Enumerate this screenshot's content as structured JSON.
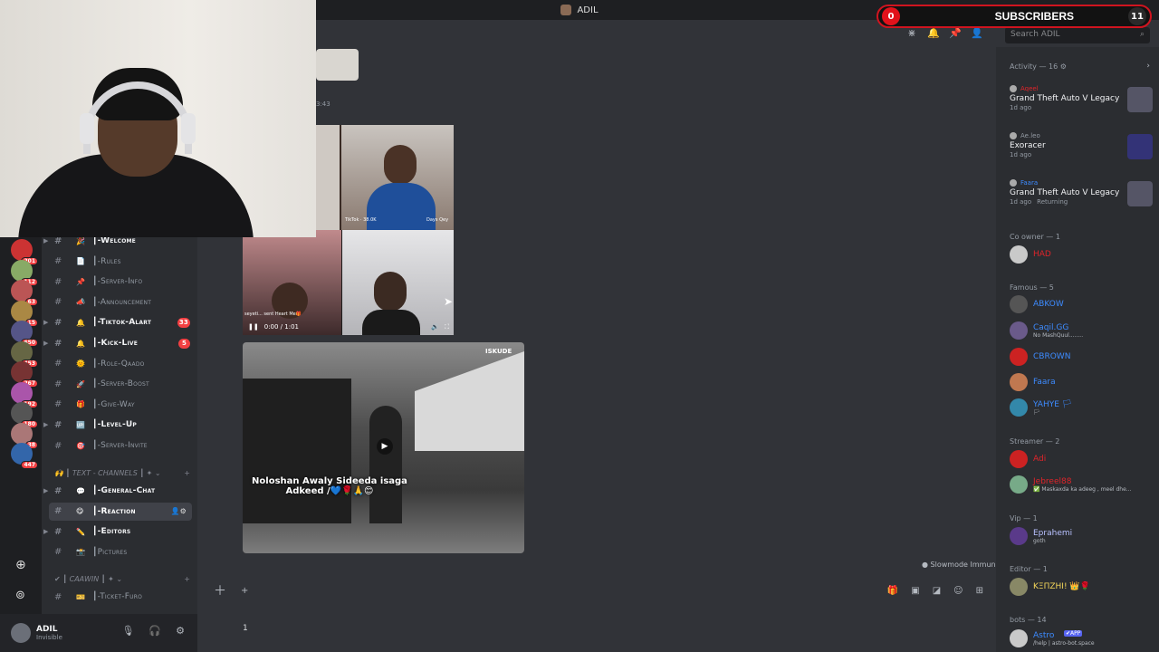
{
  "titlebar": {
    "server_name": "ADIL"
  },
  "overlay": {
    "subscribers_count": "0",
    "subscribers_label": "SUBSCRIBERS",
    "goal_number": "11"
  },
  "search": {
    "placeholder": "Search ADIL"
  },
  "guild_badges": [
    "201",
    "112",
    "63",
    "15",
    "650",
    "453",
    "267",
    "192",
    "180",
    "38",
    "447"
  ],
  "channels": [
    {
      "emoji": "🎉",
      "name": "┃-Welcome",
      "bold": true
    },
    {
      "emoji": "📄",
      "name": "┃-Rules",
      "bold": false
    },
    {
      "emoji": "📌",
      "name": "┃-Server-Info",
      "bold": false
    },
    {
      "emoji": "📣",
      "name": "┃-Announcement",
      "bold": false
    },
    {
      "emoji": "🔔",
      "name": "┃-Tiktok-Alart",
      "bold": true,
      "badge": "33"
    },
    {
      "emoji": "🔔",
      "name": "┃-Kick-Live",
      "bold": true,
      "badge": "5"
    },
    {
      "emoji": "🌞",
      "name": "┃-Role-Qaado",
      "bold": false
    },
    {
      "emoji": "🚀",
      "name": "┃-Server-Boost",
      "bold": false
    },
    {
      "emoji": "🎁",
      "name": "┃-Give-Way",
      "bold": false
    },
    {
      "emoji": "🆙",
      "name": "┃-Level-Up",
      "bold": true
    },
    {
      "emoji": "🎯",
      "name": "┃-Server-Invite",
      "bold": false
    }
  ],
  "category_text": "🙌 ┃ TEXT - CHANNELS ┃ ✦ ⌄",
  "channels2": [
    {
      "emoji": "💬",
      "name": "┃-General-Chat",
      "bold": true
    },
    {
      "emoji": "😋",
      "name": "┃-Reaction",
      "bold": true,
      "selected": true
    },
    {
      "emoji": "✏️",
      "name": "┃-Editors",
      "bold": true
    },
    {
      "emoji": "📸",
      "name": "┃Pictures",
      "bold": false
    }
  ],
  "category_caawin": "✔ ┃ CAAWIN ┃ ✦ ⌄",
  "channels3": [
    {
      "emoji": "🎫",
      "name": "┃-Ticket-Furo",
      "bold": false
    }
  ],
  "user": {
    "name": "ADIL",
    "status": "Invisible"
  },
  "messages": {
    "timestamp": "3:43",
    "video_time": "0:00 / 1:01",
    "video_watermark": "ISKUDE",
    "video_caption": "Noloshan Awaly Sideeda isaga Adkeed /💙🌹🙏😊",
    "thumb_text_a": "TikTok · 38.0K",
    "thumb_text_b": "Days Qey",
    "thumb_text_c": "seyeti... sent Heart Me🎁"
  },
  "slowmode": "Slowmode Immune",
  "composer": {
    "typing_value": "1"
  },
  "activity": {
    "header": "Activity — 16",
    "items": [
      {
        "user": "Aqeel",
        "user_color": "#e0242a",
        "game": "Grand Theft Auto V Legacy",
        "ago": "1d ago"
      },
      {
        "user": "Ae.leo",
        "user_color": "#949ba4",
        "game": "Exoracer",
        "ago": "1d ago"
      },
      {
        "user": "Faara",
        "user_color": "#3d8bff",
        "game": "Grand Theft Auto V Legacy",
        "ago": "1d ago",
        "extra": "Returning"
      }
    ]
  },
  "member_groups": [
    {
      "header": "Co owner — 1",
      "members": [
        {
          "name": "HAD",
          "color": "#e0242a",
          "sub": ""
        }
      ]
    },
    {
      "header": "Famous — 5",
      "members": [
        {
          "name": "ABKOW",
          "color": "#3d8bff",
          "sub": ""
        },
        {
          "name": "Caqil.GG",
          "color": "#3d8bff",
          "sub": "No MashQuul........"
        },
        {
          "name": "CBROWN",
          "color": "#3d8bff",
          "sub": ""
        },
        {
          "name": "Faara",
          "color": "#3d8bff",
          "sub": ""
        },
        {
          "name": "YAHYE 🏳",
          "color": "#3d8bff",
          "sub": "🏳"
        }
      ]
    },
    {
      "header": "Streamer — 2",
      "members": [
        {
          "name": "Adi",
          "color": "#e0242a",
          "sub": ""
        },
        {
          "name": "Jebreel88",
          "color": "#e0242a",
          "sub": "✅ Maskaxda ka adeeg , meel dhe..."
        }
      ]
    },
    {
      "header": "Vip — 1",
      "members": [
        {
          "name": "Eprahemi",
          "color": "#b8c1ff",
          "sub": "goth"
        }
      ]
    },
    {
      "header": "Editor — 1",
      "members": [
        {
          "name": "KΞΠZHI! 👑🌹",
          "color": "#f5d75a",
          "sub": ""
        }
      ]
    },
    {
      "header": "bots — 14",
      "members": [
        {
          "name": "Astro",
          "color": "#3d8bff",
          "sub": "/help | astro-bot.space",
          "tag": "✔APP"
        }
      ]
    }
  ]
}
